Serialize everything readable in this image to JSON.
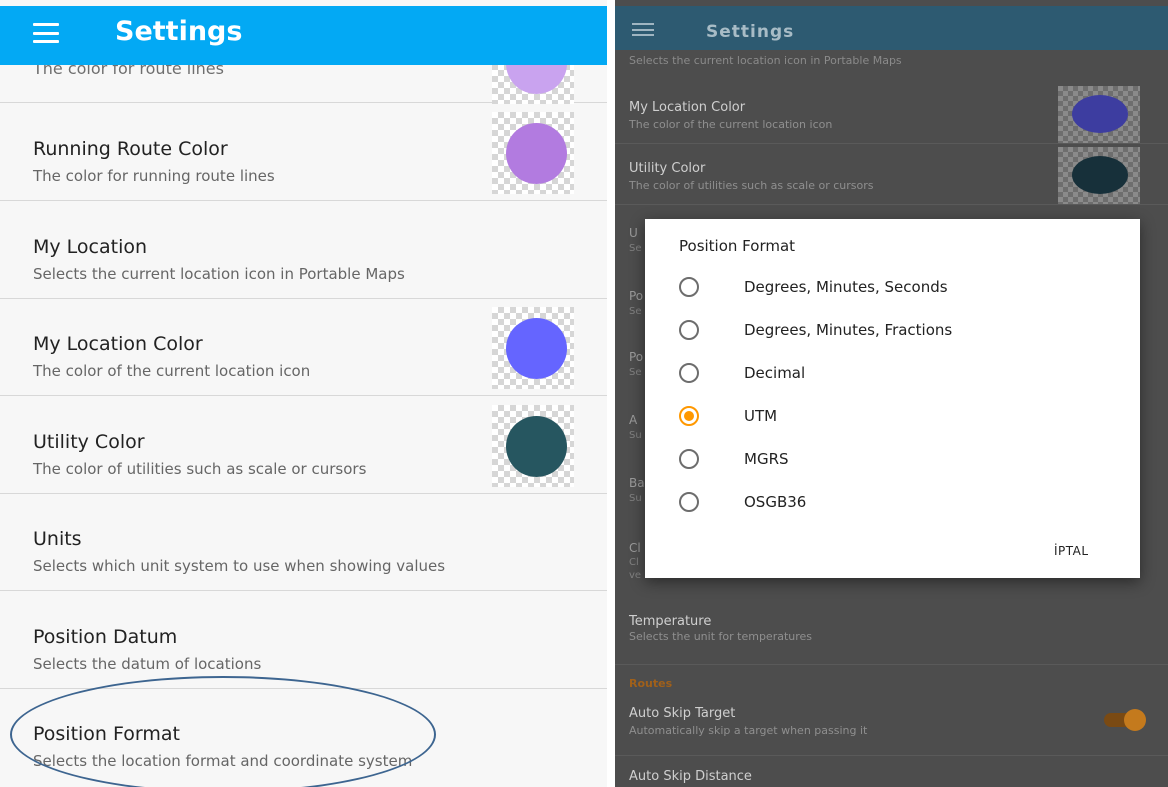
{
  "left": {
    "appbar_title": "Settings",
    "partial_summary": "The color for route lines",
    "rows": [
      {
        "title": "Running Route Color",
        "summary": "The color for running route lines",
        "swatch": "#b27be0"
      },
      {
        "title": "My Location",
        "summary": "Selects the current location icon in Portable Maps"
      },
      {
        "title": "My Location Color",
        "summary": "The color of the current location icon",
        "swatch": "#6565ff"
      },
      {
        "title": "Utility Color",
        "summary": "The color of utilities such as scale or cursors",
        "swatch": "#265660"
      },
      {
        "title": "Units",
        "summary": "Selects which unit system to use when showing values"
      },
      {
        "title": "Position Datum",
        "summary": "Selects the datum of locations"
      },
      {
        "title": "Position Format",
        "summary": "Selects the location format and coordinate system"
      }
    ],
    "partial_swatch": "#c9a3ef"
  },
  "right": {
    "appbar_title": "Settings",
    "partial_summary": "Selects the current location icon in Portable Maps",
    "rows": [
      {
        "title": "My Location Color",
        "summary": "The color of the current location icon",
        "swatch": "#3d3da0"
      },
      {
        "title": "Utility Color",
        "summary": "The color of utilities such as scale or cursors",
        "swatch": "#17303a"
      }
    ],
    "obscured_letters": [
      "U",
      "Se",
      "Po",
      "Se",
      "Po",
      "Se",
      "A",
      "Su",
      "Ba",
      "Su",
      "Cl",
      "Cl",
      "ve"
    ],
    "temperature": {
      "title": "Temperature",
      "summary": "Selects the unit for temperatures"
    },
    "section_routes": "Routes",
    "auto_skip_target": {
      "title": "Auto Skip Target",
      "summary": "Automatically skip a target when passing it"
    },
    "auto_skip_distance": {
      "title": "Auto Skip Distance"
    }
  },
  "dialog": {
    "title": "Position Format",
    "options": [
      {
        "label": "Degrees, Minutes, Seconds",
        "checked": false
      },
      {
        "label": "Degrees, Minutes, Fractions",
        "checked": false
      },
      {
        "label": "Decimal",
        "checked": false
      },
      {
        "label": "UTM",
        "checked": true
      },
      {
        "label": "MGRS",
        "checked": false
      },
      {
        "label": "OSGB36",
        "checked": false
      }
    ],
    "cancel_label": "İPTAL"
  },
  "colors": {
    "appbar_light": "#03a9f4",
    "appbar_dark": "#2d5a71",
    "accent": "#ff9800",
    "annotation": "#3d6590"
  }
}
